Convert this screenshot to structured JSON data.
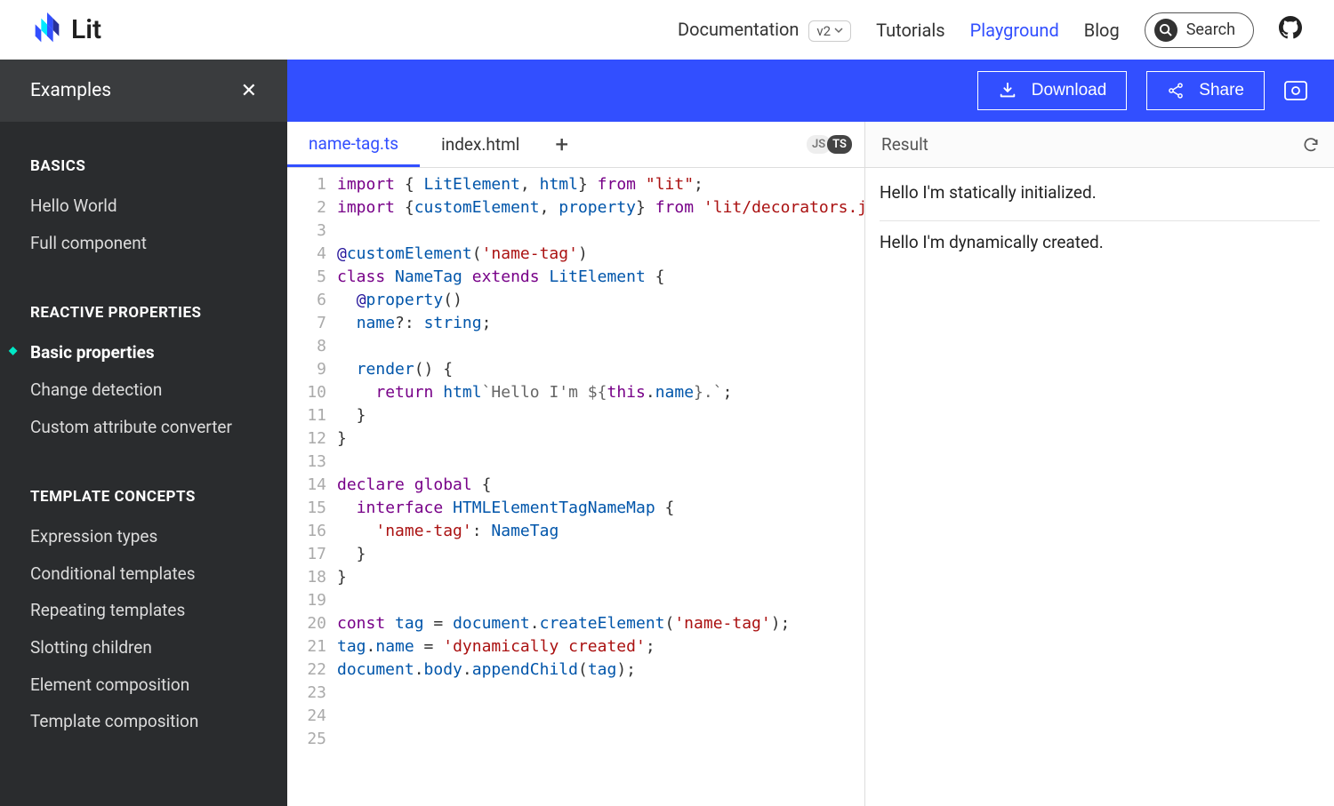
{
  "header": {
    "brand": "Lit",
    "nav": {
      "documentation": "Documentation",
      "version": "v2",
      "tutorials": "Tutorials",
      "playground": "Playground",
      "blog": "Blog",
      "search": "Search"
    }
  },
  "sidebar": {
    "title": "Examples",
    "sections": [
      {
        "heading": "BASICS",
        "items": [
          "Hello World",
          "Full component"
        ]
      },
      {
        "heading": "REACTIVE PROPERTIES",
        "items": [
          "Basic properties",
          "Change detection",
          "Custom attribute converter"
        ],
        "active_index": 0
      },
      {
        "heading": "TEMPLATE CONCEPTS",
        "items": [
          "Expression types",
          "Conditional templates",
          "Repeating templates",
          "Slotting children",
          "Element composition",
          "Template composition"
        ]
      }
    ]
  },
  "toolbar": {
    "download": "Download",
    "share": "Share"
  },
  "editor": {
    "tabs": [
      "name-tag.ts",
      "index.html"
    ],
    "active_tab": 0,
    "lang_js": "JS",
    "lang_ts": "TS",
    "code": [
      [
        [
          "kw",
          "import"
        ],
        [
          "pun",
          " { "
        ],
        [
          "id",
          "LitElement"
        ],
        [
          "pun",
          ", "
        ],
        [
          "id",
          "html"
        ],
        [
          "pun",
          "} "
        ],
        [
          "kw",
          "from"
        ],
        [
          "pun",
          " "
        ],
        [
          "str",
          "\"lit\""
        ],
        [
          "pun",
          ";"
        ]
      ],
      [
        [
          "kw",
          "import"
        ],
        [
          "pun",
          " {"
        ],
        [
          "id",
          "customElement"
        ],
        [
          "pun",
          ", "
        ],
        [
          "id",
          "property"
        ],
        [
          "pun",
          "} "
        ],
        [
          "kw",
          "from"
        ],
        [
          "pun",
          " "
        ],
        [
          "str",
          "'lit/decorators.js'"
        ],
        [
          "pun",
          ";"
        ]
      ],
      [],
      [
        [
          "dec",
          "@"
        ],
        [
          "id",
          "customElement"
        ],
        [
          "pun",
          "("
        ],
        [
          "str",
          "'name-tag'"
        ],
        [
          "pun",
          ")"
        ]
      ],
      [
        [
          "kw",
          "class"
        ],
        [
          "pun",
          " "
        ],
        [
          "id",
          "NameTag"
        ],
        [
          "pun",
          " "
        ],
        [
          "kw",
          "extends"
        ],
        [
          "pun",
          " "
        ],
        [
          "id",
          "LitElement"
        ],
        [
          "pun",
          " {"
        ]
      ],
      [
        [
          "pun",
          "  "
        ],
        [
          "dec",
          "@"
        ],
        [
          "id",
          "property"
        ],
        [
          "pun",
          "()"
        ]
      ],
      [
        [
          "pun",
          "  "
        ],
        [
          "id",
          "name"
        ],
        [
          "pun",
          "?: "
        ],
        [
          "id",
          "string"
        ],
        [
          "pun",
          ";"
        ]
      ],
      [],
      [
        [
          "pun",
          "  "
        ],
        [
          "id",
          "render"
        ],
        [
          "pun",
          "() {"
        ]
      ],
      [
        [
          "pun",
          "    "
        ],
        [
          "kw",
          "return"
        ],
        [
          "pun",
          " "
        ],
        [
          "id",
          "html"
        ],
        [
          "tpl",
          "`Hello I'm ${"
        ],
        [
          "kw",
          "this"
        ],
        [
          "pun",
          "."
        ],
        [
          "id",
          "name"
        ],
        [
          "tpl",
          "}.`"
        ],
        [
          "pun",
          ";"
        ]
      ],
      [
        [
          "pun",
          "  }"
        ]
      ],
      [
        [
          "pun",
          "}"
        ]
      ],
      [],
      [
        [
          "kw",
          "declare"
        ],
        [
          "pun",
          " "
        ],
        [
          "kw",
          "global"
        ],
        [
          "pun",
          " {"
        ]
      ],
      [
        [
          "pun",
          "  "
        ],
        [
          "kw",
          "interface"
        ],
        [
          "pun",
          " "
        ],
        [
          "id",
          "HTMLElementTagNameMap"
        ],
        [
          "pun",
          " {"
        ]
      ],
      [
        [
          "pun",
          "    "
        ],
        [
          "str",
          "'name-tag'"
        ],
        [
          "pun",
          ": "
        ],
        [
          "id",
          "NameTag"
        ]
      ],
      [
        [
          "pun",
          "  }"
        ]
      ],
      [
        [
          "pun",
          "}"
        ]
      ],
      [],
      [
        [
          "kw",
          "const"
        ],
        [
          "pun",
          " "
        ],
        [
          "id",
          "tag"
        ],
        [
          "pun",
          " = "
        ],
        [
          "id",
          "document"
        ],
        [
          "pun",
          "."
        ],
        [
          "id",
          "createElement"
        ],
        [
          "pun",
          "("
        ],
        [
          "str",
          "'name-tag'"
        ],
        [
          "pun",
          ");"
        ]
      ],
      [
        [
          "id",
          "tag"
        ],
        [
          "pun",
          "."
        ],
        [
          "id",
          "name"
        ],
        [
          "pun",
          " = "
        ],
        [
          "str",
          "'dynamically created'"
        ],
        [
          "pun",
          ";"
        ]
      ],
      [
        [
          "id",
          "document"
        ],
        [
          "pun",
          "."
        ],
        [
          "id",
          "body"
        ],
        [
          "pun",
          "."
        ],
        [
          "id",
          "appendChild"
        ],
        [
          "pun",
          "("
        ],
        [
          "id",
          "tag"
        ],
        [
          "pun",
          ");"
        ]
      ],
      [],
      [],
      []
    ]
  },
  "result": {
    "heading": "Result",
    "lines": [
      "Hello I'm statically initialized.",
      "Hello I'm dynamically created."
    ]
  }
}
